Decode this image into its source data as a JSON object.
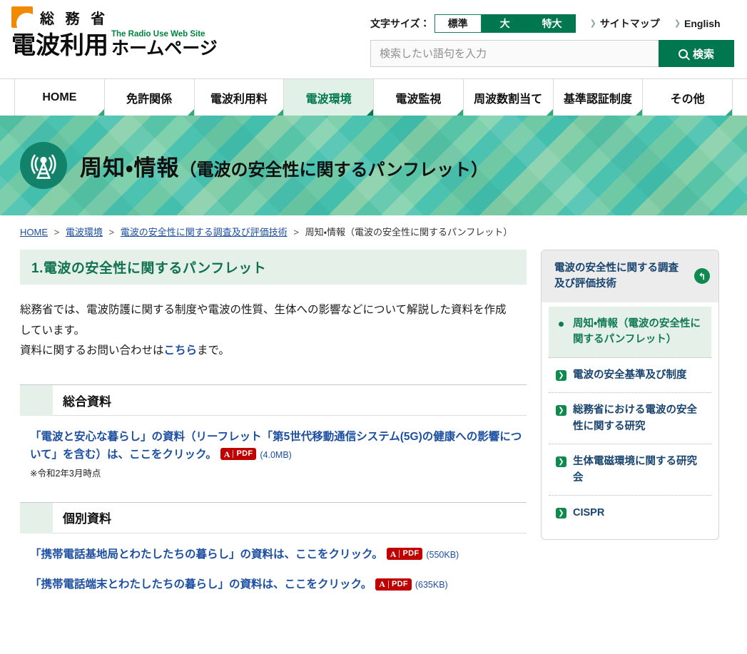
{
  "header": {
    "ministry_name": "総 務 省",
    "site_title_main": "電波利用",
    "site_title_en": "The Radio Use Web Site",
    "site_title_kana": "ホームページ",
    "fontsize_label": "文字サイズ：",
    "fontsize_options": [
      "標準",
      "大",
      "特大"
    ],
    "fontsize_selected": "標準",
    "sitemap_link": "サイトマップ",
    "english_link": "English",
    "search_placeholder": "検索したい語句を入力",
    "search_value": "",
    "search_button": "検索"
  },
  "nav": {
    "items": [
      {
        "label": "HOME",
        "active": false
      },
      {
        "label": "免許関係",
        "active": false
      },
      {
        "label": "電波利用料",
        "active": false
      },
      {
        "label": "電波環境",
        "active": true
      },
      {
        "label": "電波監視",
        "active": false
      },
      {
        "label": "周波数割当て",
        "active": false
      },
      {
        "label": "基準認証制度",
        "active": false
      },
      {
        "label": "その他",
        "active": false
      }
    ]
  },
  "banner": {
    "title_main": "周知・情報",
    "title_sub": "（電波の安全性に関するパンフレット）",
    "icon": "radio-tower-icon"
  },
  "breadcrumb": {
    "items": [
      {
        "label": "HOME",
        "link": true
      },
      {
        "label": "電波環境",
        "link": true
      },
      {
        "label": "電波の安全性に関する調査及び評価技術",
        "link": true
      },
      {
        "label": "周知・情報（電波の安全性に関するパンフレット）",
        "link": false
      }
    ],
    "separator": ">"
  },
  "main": {
    "section_heading": "1.電波の安全性に関するパンフレット",
    "intro_line1": "総務省では、電波防護に関する制度や電波の性質、生体への影響などについて解説した資料を作成",
    "intro_line2": "しています。",
    "intro_line3_pre": "資料に関するお問い合わせは",
    "intro_link": "こちら",
    "intro_line3_post": "まで。",
    "blocks": [
      {
        "title": "総合資料",
        "links": [
          {
            "text": "「電波と安心な暮らし」の資料（リーフレット「第5世代移動通信システム(5G)の健康への影響について」を含む）は、ここをクリック。",
            "badge": "PDF",
            "size": "(4.0MB)",
            "note": "※令和2年3月時点"
          }
        ]
      },
      {
        "title": "個別資料",
        "links": [
          {
            "text": "「携帯電話基地局とわたしたちの暮らし」の資料は、ここをクリック。",
            "badge": "PDF",
            "size": "(550KB)",
            "note": ""
          },
          {
            "text": "「携帯電話端末とわたしたちの暮らし」の資料は、ここをクリック。",
            "badge": "PDF",
            "size": "(635KB)",
            "note": ""
          }
        ]
      }
    ]
  },
  "sidebar": {
    "heading": "電波の安全性に関する調査及び評価技術",
    "back_icon": "↰",
    "items": [
      {
        "label": "周知・情報（電波の安全性に関するパンフレット）",
        "active": true
      },
      {
        "label": "電波の安全基準及び制度",
        "active": false
      },
      {
        "label": "総務省における電波の安全性に関する研究",
        "active": false
      },
      {
        "label": "生体電磁環境に関する研究会",
        "active": false
      },
      {
        "label": "CISPR",
        "active": false
      }
    ]
  },
  "colors": {
    "brand_green": "#00774F",
    "accent_green": "#0E8A4F",
    "light_green": "#E4F0E8",
    "link_blue": "#1c4fa1",
    "pdf_red": "#C00000",
    "logo_orange": "#F08A00"
  }
}
